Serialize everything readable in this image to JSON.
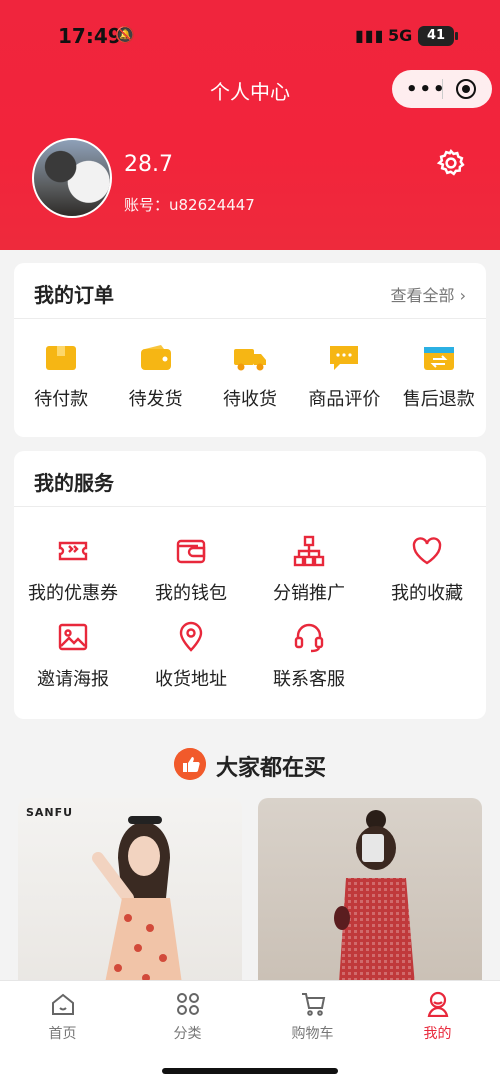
{
  "status": {
    "time": "17:49",
    "network": "5G",
    "battery": "41"
  },
  "nav": {
    "title": "个人中心"
  },
  "user": {
    "name": "28.7",
    "account": "账号：u82624447"
  },
  "orders": {
    "title": "我的订单",
    "view_all": "查看全部",
    "items": [
      {
        "label": "待付款",
        "icon": "wallet-box-icon"
      },
      {
        "label": "待发货",
        "icon": "wallet-icon"
      },
      {
        "label": "待收货",
        "icon": "truck-icon"
      },
      {
        "label": "商品评价",
        "icon": "comment-icon"
      },
      {
        "label": "售后退款",
        "icon": "refund-icon"
      }
    ]
  },
  "services": {
    "title": "我的服务",
    "items": [
      {
        "label": "我的优惠券",
        "icon": "coupon-icon"
      },
      {
        "label": "我的钱包",
        "icon": "wallet-icon"
      },
      {
        "label": "分销推广",
        "icon": "network-icon"
      },
      {
        "label": "我的收藏",
        "icon": "heart-icon"
      },
      {
        "label": "邀请海报",
        "icon": "image-icon"
      },
      {
        "label": "收货地址",
        "icon": "location-icon"
      },
      {
        "label": "联系客服",
        "icon": "headset-icon"
      }
    ]
  },
  "recommend": {
    "title": "大家都在买",
    "brand": "SANFU"
  },
  "tabbar": {
    "items": [
      {
        "label": "首页",
        "icon": "home-icon"
      },
      {
        "label": "分类",
        "icon": "grid-icon"
      },
      {
        "label": "购物车",
        "icon": "cart-icon"
      },
      {
        "label": "我的",
        "icon": "user-icon",
        "active": true
      }
    ]
  },
  "colors": {
    "brand": "#f0253d",
    "accent": "#e8283b",
    "icon_yellow": "#f6b614"
  }
}
